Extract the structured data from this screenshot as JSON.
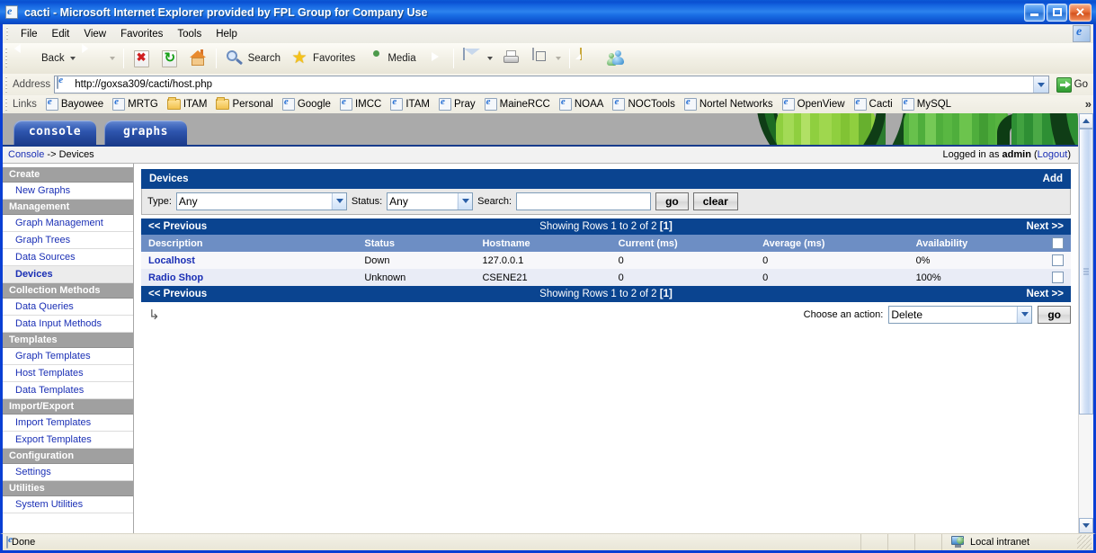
{
  "window": {
    "title": "cacti - Microsoft Internet Explorer provided by FPL Group for Company Use",
    "icon": "ie-document-icon",
    "minimize_label": "Minimize",
    "maximize_label": "Maximize",
    "close_label": "Close"
  },
  "menubar": {
    "items": [
      {
        "label": "File"
      },
      {
        "label": "Edit"
      },
      {
        "label": "View"
      },
      {
        "label": "Favorites"
      },
      {
        "label": "Tools"
      },
      {
        "label": "Help"
      }
    ]
  },
  "toolbar": {
    "back_label": "Back",
    "search_label": "Search",
    "favorites_label": "Favorites",
    "media_label": "Media"
  },
  "address": {
    "label": "Address",
    "url": "http://goxsa309/cacti/host.php",
    "go_label": "Go"
  },
  "links": {
    "label": "Links",
    "more": "»",
    "items": [
      {
        "label": "Bayowee",
        "icon": "ie-page-icon"
      },
      {
        "label": "MRTG",
        "icon": "ie-page-icon"
      },
      {
        "label": "ITAM",
        "icon": "folder-icon"
      },
      {
        "label": "Personal",
        "icon": "folder-icon"
      },
      {
        "label": "Google",
        "icon": "ie-page-icon"
      },
      {
        "label": "IMCC",
        "icon": "ie-page-icon"
      },
      {
        "label": "ITAM",
        "icon": "ie-page-icon"
      },
      {
        "label": "Pray",
        "icon": "ie-page-icon"
      },
      {
        "label": "MaineRCC",
        "icon": "ie-page-icon"
      },
      {
        "label": "NOAA",
        "icon": "ie-page-icon"
      },
      {
        "label": "NOCTools",
        "icon": "ie-page-icon"
      },
      {
        "label": "Nortel Networks",
        "icon": "ie-page-icon"
      },
      {
        "label": "OpenView",
        "icon": "ie-page-icon"
      },
      {
        "label": "Cacti",
        "icon": "ie-page-icon"
      },
      {
        "label": "MySQL",
        "icon": "ie-page-icon"
      }
    ]
  },
  "cacti": {
    "tabs": [
      {
        "label": "console",
        "active": true
      },
      {
        "label": "graphs",
        "active": false
      }
    ],
    "breadcrumb_link": "Console",
    "breadcrumb_sep": " -> ",
    "breadcrumb_current": "Devices",
    "logged_in_prefix": "Logged in as ",
    "logged_in_user": "admin",
    "logout_open": " (",
    "logout_label": "Logout",
    "logout_close": ")"
  },
  "sidebar": {
    "items": [
      {
        "label": "Create",
        "type": "header"
      },
      {
        "label": "New Graphs",
        "type": "link"
      },
      {
        "label": "Management",
        "type": "header"
      },
      {
        "label": "Graph Management",
        "type": "link"
      },
      {
        "label": "Graph Trees",
        "type": "link"
      },
      {
        "label": "Data Sources",
        "type": "link"
      },
      {
        "label": "Devices",
        "type": "link",
        "current": true
      },
      {
        "label": "Collection Methods",
        "type": "header"
      },
      {
        "label": "Data Queries",
        "type": "link"
      },
      {
        "label": "Data Input Methods",
        "type": "link"
      },
      {
        "label": "Templates",
        "type": "header"
      },
      {
        "label": "Graph Templates",
        "type": "link"
      },
      {
        "label": "Host Templates",
        "type": "link"
      },
      {
        "label": "Data Templates",
        "type": "link"
      },
      {
        "label": "Import/Export",
        "type": "header"
      },
      {
        "label": "Import Templates",
        "type": "link"
      },
      {
        "label": "Export Templates",
        "type": "link"
      },
      {
        "label": "Configuration",
        "type": "header"
      },
      {
        "label": "Settings",
        "type": "link"
      },
      {
        "label": "Utilities",
        "type": "header"
      },
      {
        "label": "System Utilities",
        "type": "link"
      }
    ]
  },
  "panel": {
    "title": "Devices",
    "add_label": "Add"
  },
  "filter": {
    "type_label": "Type:",
    "type_value": "Any",
    "status_label": "Status:",
    "status_value": "Any",
    "search_label": "Search:",
    "search_value": "",
    "search_placeholder": "",
    "go_label": "go",
    "clear_label": "clear"
  },
  "pager": {
    "previous_label": "<< Previous",
    "showing_label": "Showing Rows 1 to 2 of 2 ",
    "page_number": "[1]",
    "next_label": "Next >>"
  },
  "table": {
    "columns": [
      "Description",
      "Status",
      "Hostname",
      "Current (ms)",
      "Average (ms)",
      "Availability"
    ],
    "rows": [
      {
        "description": "Localhost",
        "status": "Down",
        "status_color": "#d10000",
        "hostname": "127.0.0.1",
        "current_ms": "0",
        "average_ms": "0",
        "availability": "0%",
        "selected": false
      },
      {
        "description": "Radio Shop",
        "status": "Unknown",
        "status_color": "#1a2fb5",
        "hostname": "CSENE21",
        "current_ms": "0",
        "average_ms": "0",
        "availability": "100%",
        "selected": false
      }
    ]
  },
  "actions": {
    "choose_label": "Choose an action:",
    "selected_action": "Delete",
    "go_label": "go"
  },
  "statusbar": {
    "message": "Done",
    "zone": "Local intranet",
    "zone_icon": "local-intranet-icon"
  },
  "colors": {
    "cacti_header_blue": "#0a4490",
    "cacti_table_head": "#6d8ec4",
    "cacti_link": "#1a2fb5",
    "menu_header_gray": "#a0a0a0",
    "banner_gray": "#aaaaaa",
    "status_down": "#d10000",
    "titlebar_blue": "#0a3fd4"
  }
}
